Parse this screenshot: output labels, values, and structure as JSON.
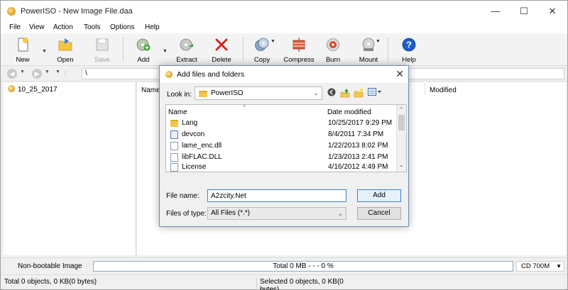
{
  "window": {
    "title": "PowerISO - New Image File.daa",
    "controls": {
      "minimize": "—",
      "maximize": "☐",
      "close": "✕"
    }
  },
  "menu": [
    "File",
    "View",
    "Action",
    "Tools",
    "Options",
    "Help"
  ],
  "toolbar": {
    "new": "New",
    "open": "Open",
    "save": "Save",
    "add": "Add",
    "extract": "Extract",
    "delete": "Delete",
    "copy": "Copy",
    "compress": "Compress",
    "burn": "Burn",
    "mount": "Mount",
    "help": "Help"
  },
  "address": {
    "path": "\\"
  },
  "tree": {
    "root": "10_25_2017"
  },
  "list_header": {
    "name": "Name",
    "modified": "Modified"
  },
  "status": {
    "boot": "Non-bootable Image",
    "total": "Total  0 MB   - - -  0 %",
    "progress": 0,
    "media": "CD 700M",
    "objects": "Total 0 objects, 0 KB(0 bytes)",
    "selected": "Selected 0 objects, 0 KB(0 bytes)"
  },
  "dialog": {
    "title": "Add files and folders",
    "close": "✕",
    "look_in_label": "Look in:",
    "look_in_value": "PowerISO",
    "columns": {
      "name": "Name",
      "date": "Date modified"
    },
    "files": [
      {
        "name": "Lang",
        "date": "10/25/2017 9:29 PM",
        "icon": "folder-icon"
      },
      {
        "name": "devcon",
        "date": "8/4/2011 7:34 PM",
        "icon": "exe-icon"
      },
      {
        "name": "lame_enc.dll",
        "date": "1/22/2013 8:02 PM",
        "icon": "dll-icon"
      },
      {
        "name": "libFLAC.DLL",
        "date": "1/23/2013 2:41 PM",
        "icon": "dll-icon"
      },
      {
        "name": "License",
        "date": "4/16/2012 4:49 PM",
        "icon": "file-icon"
      }
    ],
    "filename_label": "File name:",
    "filename_value": "A2zcity.Net",
    "filetype_label": "Files of type:",
    "filetype_value": "All Files (*.*)",
    "add_button": "Add",
    "cancel_button": "Cancel"
  },
  "colors": {
    "progress_border": "#8fa8c8",
    "dialog_border": "#6f8fb8",
    "focus": "#3c7fd0"
  }
}
